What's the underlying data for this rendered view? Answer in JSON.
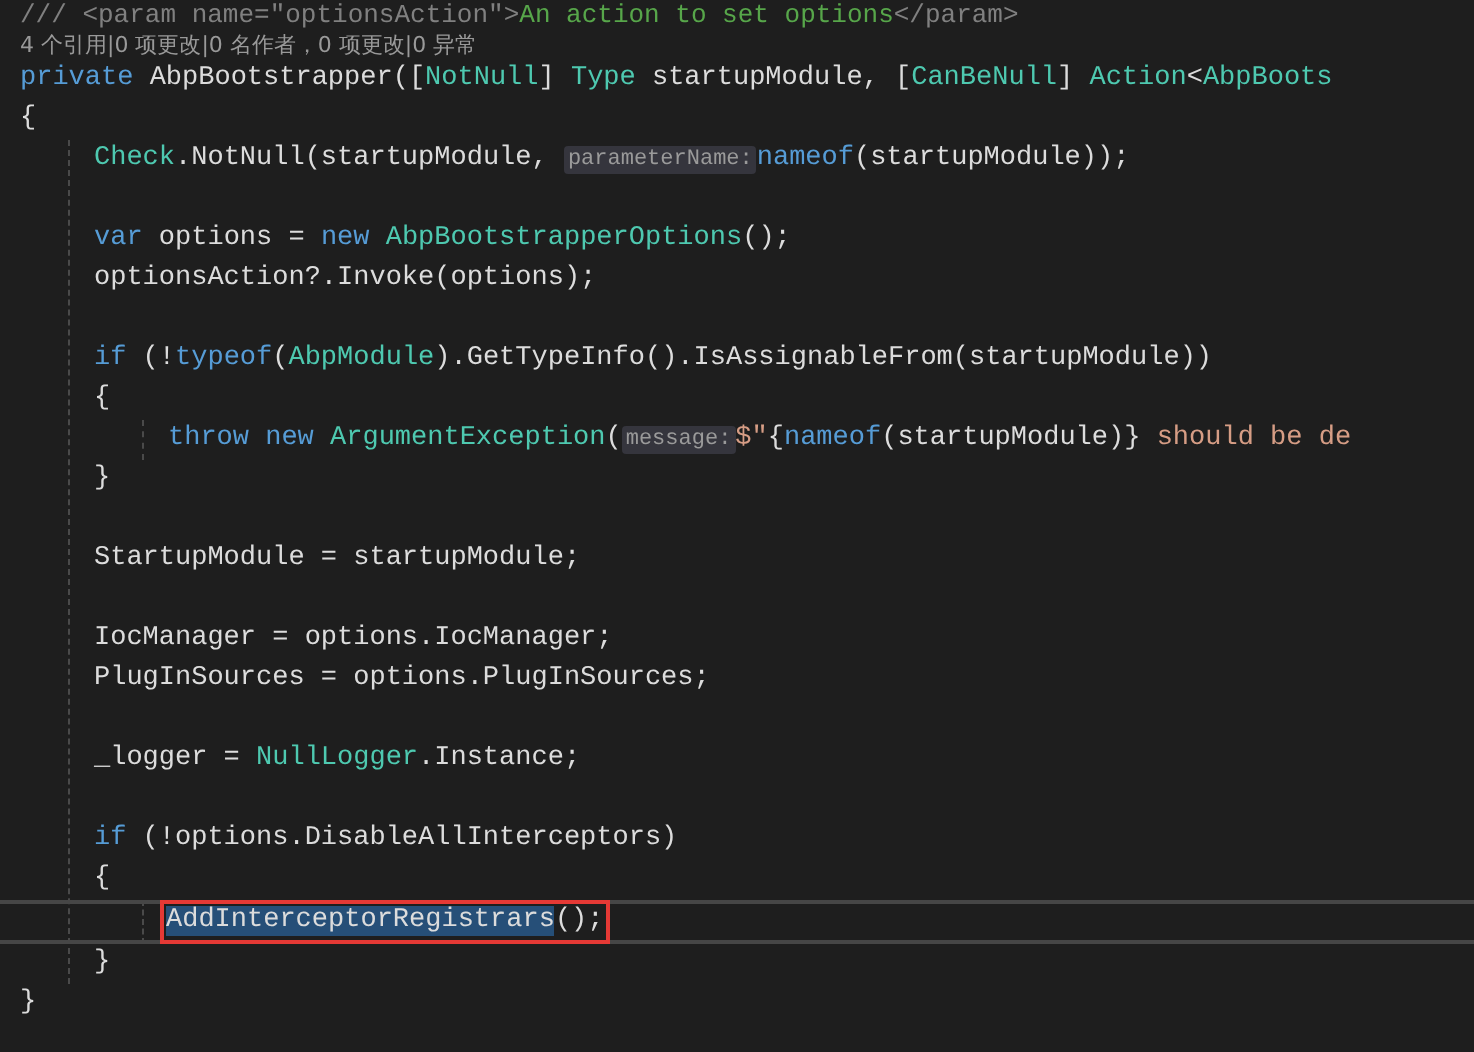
{
  "editor": {
    "lines": [
      {
        "tokens": [
          {
            "text": "/// <param name=\"optionsAction\">",
            "kind": "doctag"
          },
          {
            "text": "An action to set options",
            "kind": "comment"
          },
          {
            "text": "</param>",
            "kind": "doctag"
          }
        ]
      },
      {
        "kind": "codelens",
        "text": "4 个引用|0 项更改|0 名作者，0 项更改|0 异常"
      },
      {
        "tokens": [
          {
            "text": "private",
            "kind": "keyword"
          },
          {
            "text": " AbpBootstrapper([",
            "kind": "plain"
          },
          {
            "text": "NotNull",
            "kind": "type"
          },
          {
            "text": "] ",
            "kind": "plain"
          },
          {
            "text": "Type",
            "kind": "type"
          },
          {
            "text": " startupModule, [",
            "kind": "plain"
          },
          {
            "text": "CanBeNull",
            "kind": "type"
          },
          {
            "text": "] ",
            "kind": "plain"
          },
          {
            "text": "Action",
            "kind": "type"
          },
          {
            "text": "<",
            "kind": "plain"
          },
          {
            "text": "AbpBoots",
            "kind": "type"
          }
        ]
      },
      {
        "tokens": [
          {
            "text": "{",
            "kind": "plain"
          }
        ]
      },
      {
        "kind": "block",
        "children": [
          {
            "tokens": [
              {
                "text": "Check",
                "kind": "type"
              },
              {
                "text": ".NotNull(startupModule, ",
                "kind": "plain"
              },
              {
                "text": "parameterName:",
                "kind": "hint"
              },
              {
                "text": "nameof",
                "kind": "keyword"
              },
              {
                "text": "(startupModule));",
                "kind": "plain"
              }
            ]
          },
          {
            "kind": "blank"
          },
          {
            "tokens": [
              {
                "text": "var",
                "kind": "keyword"
              },
              {
                "text": " options = ",
                "kind": "plain"
              },
              {
                "text": "new",
                "kind": "keyword"
              },
              {
                "text": " AbpBootstrapperOptions",
                "kind": "type"
              },
              {
                "text": "();",
                "kind": "plain"
              }
            ]
          },
          {
            "tokens": [
              {
                "text": "optionsAction?.Invoke(options);",
                "kind": "plain"
              }
            ]
          },
          {
            "kind": "blank"
          },
          {
            "tokens": [
              {
                "text": "if",
                "kind": "keyword"
              },
              {
                "text": " (!",
                "kind": "plain"
              },
              {
                "text": "typeof",
                "kind": "keyword"
              },
              {
                "text": "(",
                "kind": "plain"
              },
              {
                "text": "AbpModule",
                "kind": "type"
              },
              {
                "text": ").GetTypeInfo().IsAssignableFrom(startupModule))",
                "kind": "plain"
              }
            ]
          },
          {
            "tokens": [
              {
                "text": "{",
                "kind": "plain"
              }
            ]
          },
          {
            "kind": "block",
            "children": [
              {
                "tokens": [
                  {
                    "text": "throw new",
                    "kind": "keyword"
                  },
                  {
                    "text": " ArgumentException",
                    "kind": "type"
                  },
                  {
                    "text": "(",
                    "kind": "plain"
                  },
                  {
                    "text": "message:",
                    "kind": "hint"
                  },
                  {
                    "text": "$\"",
                    "kind": "string"
                  },
                  {
                    "text": "{",
                    "kind": "plain"
                  },
                  {
                    "text": "nameof",
                    "kind": "keyword"
                  },
                  {
                    "text": "(startupModule)} ",
                    "kind": "plain"
                  },
                  {
                    "text": "should be de",
                    "kind": "string"
                  }
                ]
              }
            ]
          },
          {
            "tokens": [
              {
                "text": "}",
                "kind": "plain"
              }
            ]
          },
          {
            "kind": "blank"
          },
          {
            "tokens": [
              {
                "text": "StartupModule = startupModule;",
                "kind": "plain"
              }
            ]
          },
          {
            "kind": "blank"
          },
          {
            "tokens": [
              {
                "text": "IocManager = options.IocManager;",
                "kind": "plain"
              }
            ]
          },
          {
            "tokens": [
              {
                "text": "PlugInSources = options.PlugInSources;",
                "kind": "plain"
              }
            ]
          },
          {
            "kind": "blank"
          },
          {
            "tokens": [
              {
                "text": "_logger = ",
                "kind": "plain"
              },
              {
                "text": "NullLogger",
                "kind": "type"
              },
              {
                "text": ".Instance;",
                "kind": "plain"
              }
            ]
          },
          {
            "kind": "blank"
          },
          {
            "tokens": [
              {
                "text": "if",
                "kind": "keyword"
              },
              {
                "text": " (!options.DisableAllInterceptors)",
                "kind": "plain"
              }
            ]
          },
          {
            "tokens": [
              {
                "text": "{",
                "kind": "plain"
              }
            ]
          },
          {
            "kind": "block",
            "children": [
              {
                "current": true,
                "annotated": true,
                "tokens": [
                  {
                    "text": "AddInterceptorRegistrars",
                    "kind": "plain",
                    "selected": true
                  },
                  {
                    "text": "();",
                    "kind": "plain",
                    "selected": false
                  }
                ]
              }
            ]
          },
          {
            "tokens": [
              {
                "text": "}",
                "kind": "plain"
              }
            ]
          }
        ]
      },
      {
        "tokens": [
          {
            "text": "}",
            "kind": "plain"
          }
        ]
      }
    ]
  }
}
